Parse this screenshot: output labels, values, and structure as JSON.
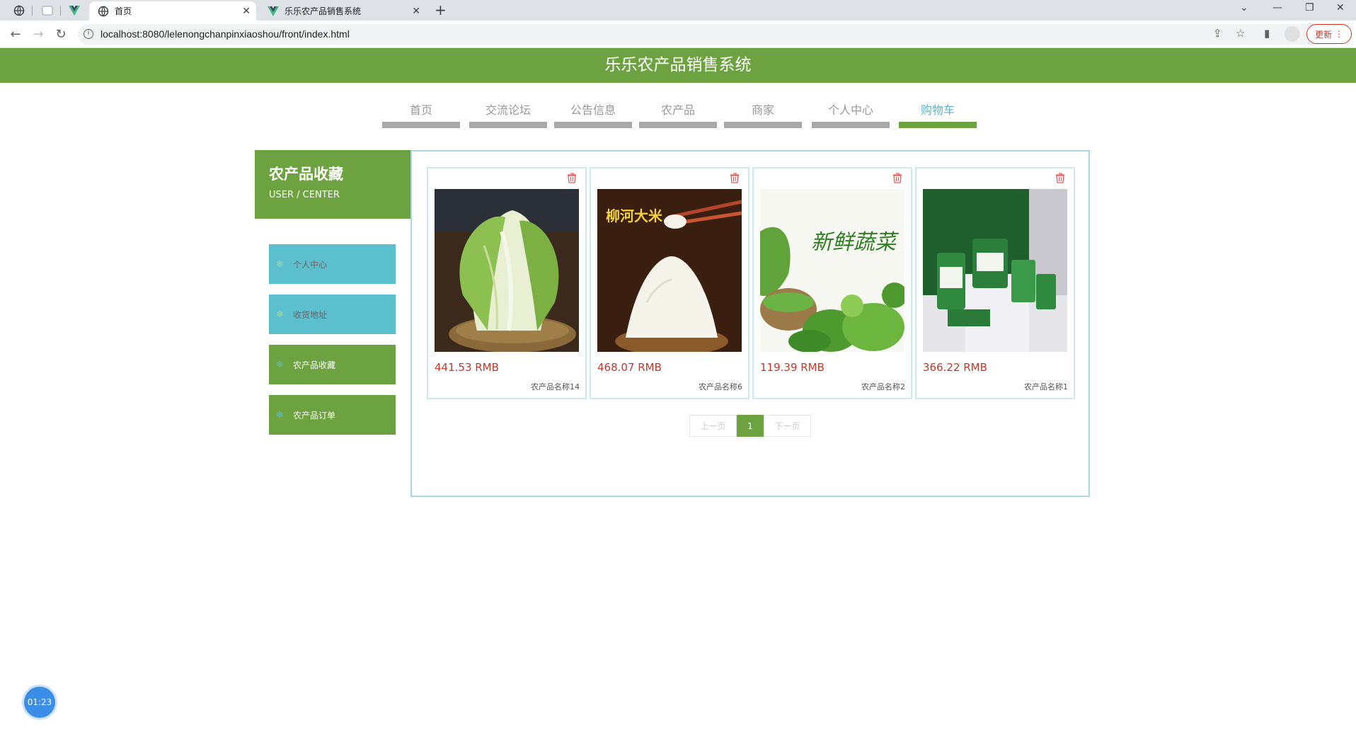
{
  "browser": {
    "tabs": [
      {
        "title": "首页",
        "icon": "globe-icon",
        "active": true
      },
      {
        "title": "乐乐农产品销售系统",
        "icon": "vue-logo-icon",
        "active": false
      }
    ],
    "url": "localhost:8080/lelenongchanpinxiaoshou/front/index.html",
    "update_label": "更新"
  },
  "site": {
    "title": "乐乐农产品销售系统",
    "nav": [
      {
        "label": "首页",
        "active": false
      },
      {
        "label": "交流论坛",
        "active": false
      },
      {
        "label": "公告信息",
        "active": false
      },
      {
        "label": "农产品",
        "active": false
      },
      {
        "label": "商家",
        "active": false
      },
      {
        "label": "个人中心",
        "active": false
      },
      {
        "label": "购物车",
        "active": true
      }
    ]
  },
  "sidebar": {
    "title": "农产品收藏",
    "subtitle": "USER / CENTER",
    "items": [
      {
        "label": "个人中心",
        "style": "blue"
      },
      {
        "label": "收货地址",
        "style": "blue"
      },
      {
        "label": "农产品收藏",
        "style": "green"
      },
      {
        "label": "农产品订单",
        "style": "green"
      }
    ]
  },
  "products": [
    {
      "price": "441.53 RMB",
      "name": "农产品名称14",
      "image": "chinese-cabbage-photo"
    },
    {
      "price": "468.07 RMB",
      "name": "农产品名称6",
      "image": "rice-bowl-photo",
      "image_text": "柳河大米"
    },
    {
      "price": "119.39 RMB",
      "name": "农产品名称2",
      "image": "fresh-vegetables-photo",
      "image_text": "新鲜蔬菜"
    },
    {
      "price": "366.22 RMB",
      "name": "农产品名称1",
      "image": "green-packaging-photo"
    }
  ],
  "pagination": {
    "prev": "上一页",
    "current": "1",
    "next": "下一页"
  },
  "timer": "01:23",
  "colors": {
    "brand_green": "#6ca23f",
    "accent_blue": "#5bbfcd",
    "price_red": "#c0392b"
  }
}
